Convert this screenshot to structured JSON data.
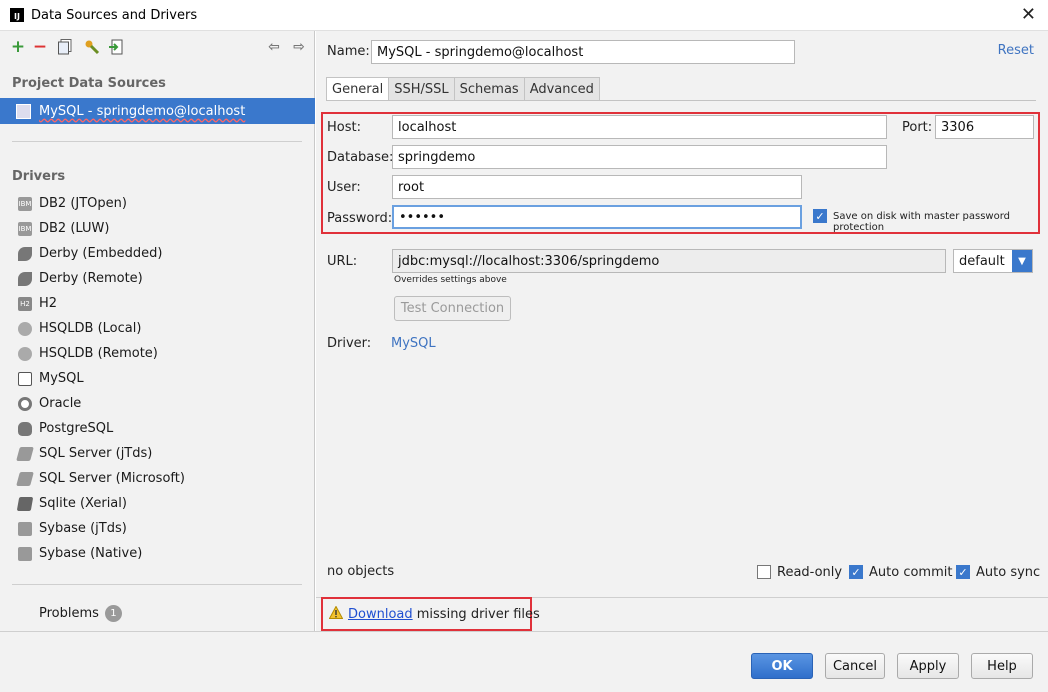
{
  "window": {
    "title": "Data Sources and Drivers",
    "app_icon_text": "IJ"
  },
  "left": {
    "section_project": "Project Data Sources",
    "selected_source": "MySQL - springdemo@localhost",
    "section_drivers": "Drivers",
    "drivers": [
      {
        "label": "DB2 (JTOpen)",
        "icon": "ibm-icon",
        "icon_text": "IBM"
      },
      {
        "label": "DB2 (LUW)",
        "icon": "ibm-icon",
        "icon_text": "IBM"
      },
      {
        "label": "Derby (Embedded)",
        "icon": "derby-icon",
        "icon_text": ""
      },
      {
        "label": "Derby (Remote)",
        "icon": "derby-icon",
        "icon_text": ""
      },
      {
        "label": "H2",
        "icon": "h2-icon",
        "icon_text": "H2"
      },
      {
        "label": "HSQLDB (Local)",
        "icon": "hsqldb-icon",
        "icon_text": ""
      },
      {
        "label": "HSQLDB (Remote)",
        "icon": "hsqldb-icon",
        "icon_text": ""
      },
      {
        "label": "MySQL",
        "icon": "mysql-icon",
        "icon_text": ""
      },
      {
        "label": "Oracle",
        "icon": "oracle-icon",
        "icon_text": ""
      },
      {
        "label": "PostgreSQL",
        "icon": "postgresql-icon",
        "icon_text": ""
      },
      {
        "label": "SQL Server (jTds)",
        "icon": "sqlserver-icon",
        "icon_text": ""
      },
      {
        "label": "SQL Server (Microsoft)",
        "icon": "sqlserver-icon",
        "icon_text": ""
      },
      {
        "label": "Sqlite (Xerial)",
        "icon": "sqlite-icon",
        "icon_text": ""
      },
      {
        "label": "Sybase (jTds)",
        "icon": "sybase-icon",
        "icon_text": ""
      },
      {
        "label": "Sybase (Native)",
        "icon": "sybase-icon",
        "icon_text": ""
      }
    ],
    "problems_label": "Problems",
    "problems_count": "1"
  },
  "right": {
    "name_label": "Name:",
    "name_value": "MySQL - springdemo@localhost",
    "reset_label": "Reset",
    "tabs": [
      "General",
      "SSH/SSL",
      "Schemas",
      "Advanced"
    ],
    "active_tab": "General",
    "host_label": "Host:",
    "host_value": "localhost",
    "port_label": "Port:",
    "port_value": "3306",
    "database_label": "Database:",
    "database_value": "springdemo",
    "user_label": "User:",
    "user_value": "root",
    "password_label": "Password:",
    "password_value": "••••••",
    "save_on_disk_label": "Save on disk with master password protection",
    "save_on_disk_checked": true,
    "url_label": "URL:",
    "url_value": "jdbc:mysql://localhost:3306/springdemo",
    "url_mode": "default",
    "overrides_note": "Overrides settings above",
    "test_connection_label": "Test Connection",
    "driver_label": "Driver:",
    "driver_value": "MySQL",
    "objects_status": "no objects",
    "read_only_label": "Read-only",
    "read_only_checked": false,
    "auto_commit_label": "Auto commit",
    "auto_commit_checked": true,
    "auto_sync_label": "Auto sync",
    "auto_sync_checked": true,
    "download_link": "Download",
    "download_rest": " missing driver files"
  },
  "buttons": {
    "ok": "OK",
    "cancel": "Cancel",
    "apply": "Apply",
    "help": "Help"
  },
  "colors": {
    "accent": "#3a78cc",
    "highlight_box": "#e0313a",
    "link": "#3f74c1"
  }
}
